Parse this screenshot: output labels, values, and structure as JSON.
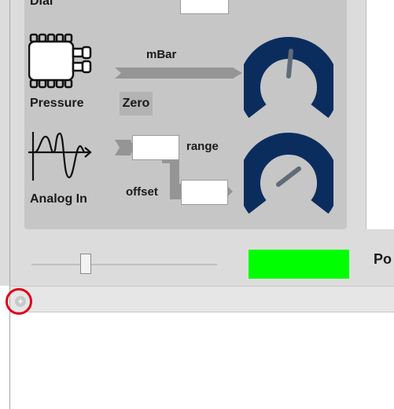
{
  "diagram": {
    "dial_label": "Dial",
    "pressure": {
      "label": "Pressure",
      "unit_label": "mBar",
      "zero_label": "Zero"
    },
    "analog_in": {
      "label": "Analog In",
      "range_label": "range",
      "offset_label": "offset"
    }
  },
  "controls": {
    "position_label": "Po"
  },
  "colors": {
    "gauge": "#0b2d5e",
    "status_indicator": "#00ff00",
    "annotation_circle": "#e0001a"
  },
  "icons": {
    "pressure_sensor": "pressure-sensor-icon",
    "waveform": "waveform-icon",
    "add": "add-icon"
  }
}
